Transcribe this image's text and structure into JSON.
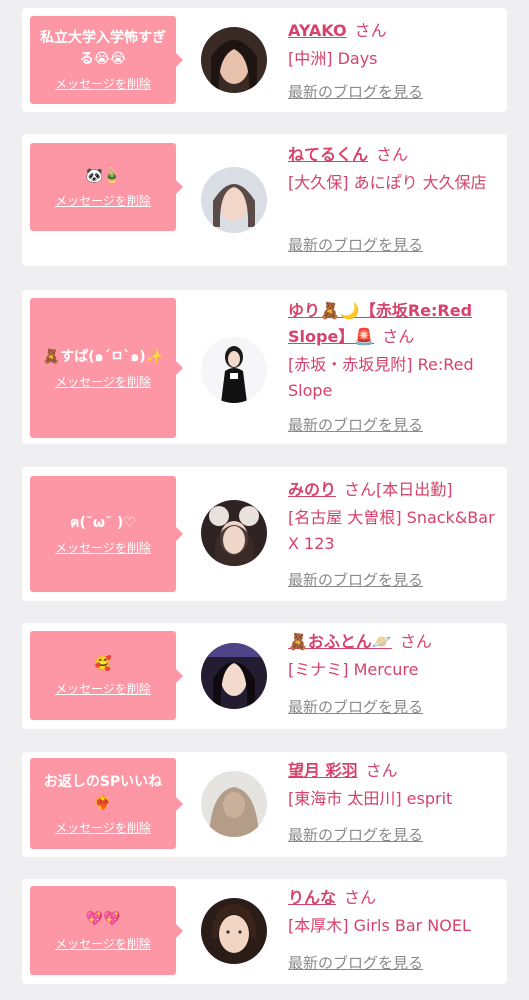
{
  "delete_label": "メッセージを削除",
  "blog_label": "最新のブログを見る",
  "honorific": "さん",
  "colors": {
    "bubble": "#fd96a5",
    "accent": "#d6426b",
    "background": "#efeff1"
  },
  "cards": [
    {
      "message": "私立大学入学怖すぎる😭😭",
      "name": "AYAKO",
      "name_suffix": "",
      "shop": "[中洲] Days"
    },
    {
      "message": "🐼🎍",
      "name": "ねてるくん",
      "name_suffix": "",
      "shop": "[大久保] あにぽり 大久保店"
    },
    {
      "message": "🧸すぱ(๑´ㅁ`๑)✨",
      "name": "ゆり🧸🌙【赤坂Re:Red Slope】🚨",
      "name_suffix": "",
      "shop": "[赤坂・赤坂見附] Re:Red Slope"
    },
    {
      "message": "ฅ(˘ω˘ )♡",
      "name": "みのり",
      "name_suffix": "[本日出勤]",
      "shop": "[名古屋 大曽根] Snack&Bar X 123"
    },
    {
      "message": "🥰",
      "name": "🧸おふとん🪐",
      "name_suffix": "",
      "shop": "[ミナミ] Mercure"
    },
    {
      "message": "お返しのSPいいね❤️‍🔥",
      "name": "望月 彩羽",
      "name_suffix": "",
      "shop": "[東海市 太田川] esprit"
    },
    {
      "message": "💖💖",
      "name": "りんな",
      "name_suffix": "",
      "shop": "[本厚木] Girls Bar NOEL"
    }
  ]
}
